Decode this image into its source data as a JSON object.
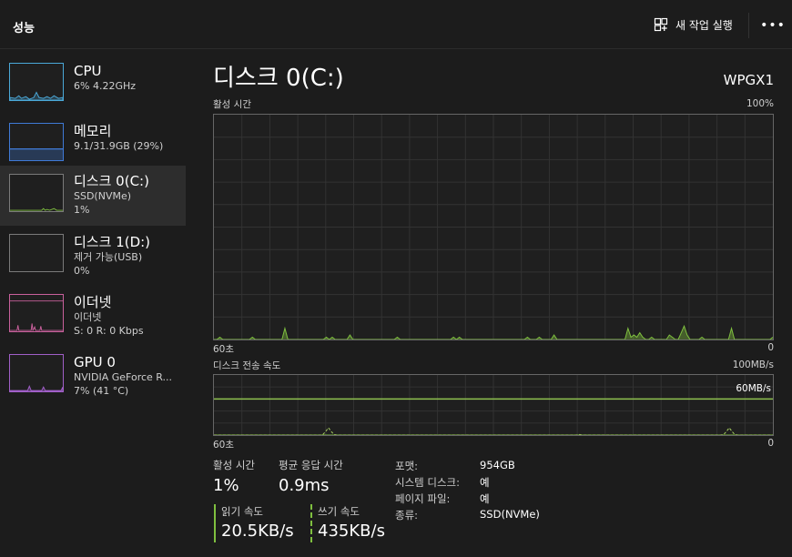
{
  "header": {
    "title": "성능",
    "new_task_label": "새 작업 실행",
    "more_label": "•••"
  },
  "sidebar": {
    "items": [
      {
        "name": "CPU",
        "sub1": "6% 4.22GHz",
        "sub2": "",
        "active": false,
        "color": "#4aa8d8"
      },
      {
        "name": "메모리",
        "sub1": "9.1/31.9GB (29%)",
        "sub2": "",
        "active": false,
        "color": "#3f7ad6"
      },
      {
        "name": "디스크 0(C:)",
        "sub1": "SSD(NVMe)",
        "sub2": "1%",
        "active": true,
        "color": "#7fbf3f"
      },
      {
        "name": "디스크 1(D:)",
        "sub1": "제거 가능(USB)",
        "sub2": "0%",
        "active": false,
        "color": "#7fbf3f"
      },
      {
        "name": "이더넷",
        "sub1": "이더넷",
        "sub2": "S: 0 R: 0 Kbps",
        "active": false,
        "color": "#c9609c"
      },
      {
        "name": "GPU 0",
        "sub1": "NVIDIA GeForce R...",
        "sub2": "7% (41 °C)",
        "active": false,
        "color": "#a05fc8"
      }
    ]
  },
  "detail": {
    "title": "디스크 0(C:)",
    "model": "WPGX1",
    "active_time_graph": {
      "label": "활성 시간",
      "max_label": "100%",
      "x_left": "60초",
      "x_right": "0",
      "values_percent": [
        0,
        0,
        1,
        0,
        0,
        0,
        0,
        0,
        0,
        0,
        0,
        0,
        0,
        1,
        0,
        0,
        0,
        0,
        0,
        0,
        0,
        0,
        0,
        0,
        5,
        0,
        0,
        0,
        0,
        0,
        0,
        0,
        0,
        0,
        0,
        0,
        0,
        0,
        1,
        0,
        1,
        0,
        0,
        0,
        0,
        0,
        2,
        0,
        0,
        0,
        0,
        0,
        0,
        0,
        0,
        0,
        0,
        0,
        0,
        0,
        0,
        0,
        1,
        0,
        0,
        0,
        0,
        0,
        0,
        0,
        0,
        0,
        0,
        0,
        0,
        0,
        0,
        0,
        0,
        0,
        0,
        1,
        0,
        1,
        0,
        0,
        0,
        0,
        0,
        0,
        0,
        0,
        0,
        0,
        0,
        0,
        0,
        0,
        0,
        0,
        0,
        0,
        0,
        0,
        0,
        0,
        1,
        0,
        0,
        0,
        1,
        0,
        0,
        0,
        0,
        2,
        0,
        0,
        0,
        0,
        0,
        0,
        0,
        0,
        0,
        0,
        0,
        0,
        0,
        0,
        0,
        0,
        0,
        0,
        0,
        0,
        0,
        0,
        0,
        0,
        5,
        1,
        2,
        1,
        3,
        1,
        0,
        0,
        1,
        0,
        0,
        0,
        0,
        0,
        2,
        1,
        0,
        0,
        3,
        6,
        2,
        0,
        0,
        0,
        0,
        1,
        0,
        0,
        0,
        0,
        0,
        0,
        0,
        0,
        0,
        5,
        0,
        0,
        0,
        0,
        0,
        0,
        0,
        0,
        0,
        0,
        0,
        0,
        0,
        1
      ]
    },
    "transfer_graph": {
      "label": "디스크 전송 속도",
      "max_label": "100MB/s",
      "line_label": "60MB/s",
      "line_value_mb": 60,
      "x_left": "60초",
      "x_right": "0",
      "read_mb": [
        0,
        0,
        0,
        0,
        0,
        0,
        0,
        0,
        0,
        0,
        0,
        0,
        0,
        0,
        0,
        0,
        0,
        0,
        0,
        0,
        0,
        0,
        0,
        0,
        0,
        0,
        0,
        0,
        0,
        0,
        0,
        0,
        0,
        0,
        0,
        0,
        0,
        0,
        0,
        0,
        0,
        0,
        0,
        0,
        0,
        0,
        0,
        0,
        0,
        0,
        0,
        0,
        0,
        0,
        0,
        0,
        0,
        0,
        0,
        0,
        0,
        0,
        0,
        0,
        0,
        0,
        0,
        0,
        0,
        0,
        0,
        0,
        0,
        0,
        0,
        0,
        0,
        0,
        0,
        0,
        0,
        0,
        0,
        0,
        0,
        0,
        0,
        0,
        0,
        0,
        0,
        0,
        0,
        0,
        0,
        0,
        0,
        0,
        0,
        0,
        0,
        0,
        0,
        0,
        0,
        0,
        0,
        0,
        0,
        0,
        0,
        0,
        0,
        0,
        0,
        0,
        0,
        0,
        0,
        0,
        0,
        0,
        0,
        0,
        0,
        0,
        0,
        0,
        0,
        0,
        0,
        0,
        0,
        0,
        0,
        0,
        0,
        0,
        0,
        0,
        0,
        0,
        0,
        0,
        0,
        0,
        0,
        0,
        0,
        0,
        0,
        0,
        0,
        0,
        0,
        0,
        0,
        0,
        0,
        0,
        0,
        0,
        0,
        0,
        0,
        0,
        0,
        0,
        0,
        0,
        0,
        0,
        0,
        0,
        0,
        0,
        0,
        0,
        0,
        0,
        0,
        0,
        0,
        0,
        0,
        0,
        0,
        0,
        0,
        0,
        0,
        0,
        0,
        0,
        0,
        0,
        0,
        0,
        0,
        0,
        0,
        0
      ],
      "write_mb": [
        0,
        0,
        0,
        0,
        0,
        0,
        0,
        0,
        0,
        0,
        0,
        0,
        0,
        0,
        0,
        0,
        0,
        0,
        0,
        0,
        0,
        0,
        0,
        0,
        0,
        0,
        0,
        0,
        0,
        0,
        0,
        0,
        0,
        0,
        0,
        0,
        0,
        0,
        0,
        0,
        1,
        6,
        12,
        6,
        1,
        0,
        0,
        0,
        0,
        0,
        0,
        0,
        0,
        0,
        0,
        0,
        0,
        0,
        0,
        0,
        0,
        0,
        0,
        0,
        0,
        0,
        0,
        0,
        0,
        0,
        0,
        0,
        0,
        0,
        0,
        0,
        0,
        0,
        0,
        0,
        0,
        0,
        0,
        0,
        0,
        0,
        0,
        0,
        0,
        0,
        0,
        0,
        0,
        0,
        0,
        0,
        0,
        0,
        0,
        0,
        0,
        0,
        0,
        0,
        0,
        0,
        0,
        0,
        0,
        0,
        0,
        0,
        0,
        0,
        0,
        0,
        0,
        0,
        0,
        0,
        0,
        0,
        0,
        0,
        0,
        0,
        0,
        0,
        0,
        0,
        0,
        0,
        0,
        0,
        1,
        0,
        0,
        0,
        0,
        0,
        0,
        0,
        0,
        0,
        0,
        0,
        0,
        0,
        0,
        0,
        0,
        0,
        0,
        0,
        0,
        0,
        0,
        0,
        0,
        0,
        0,
        0,
        0,
        0,
        0,
        0,
        0,
        0,
        0,
        0,
        0,
        0,
        0,
        0,
        0,
        0,
        0,
        0,
        0,
        0,
        0,
        0,
        0,
        0,
        0,
        0,
        0,
        1,
        6,
        12,
        6,
        1,
        0,
        0,
        0,
        0,
        0,
        0,
        0,
        0,
        0,
        0,
        0,
        0,
        0,
        0
      ]
    },
    "stats": {
      "active_time_label": "활성 시간",
      "active_time_value": "1%",
      "response_label": "평균 응답 시간",
      "response_value": "0.9ms",
      "read_label": "읽기 속도",
      "read_value": "20.5KB/s",
      "write_label": "쓰기 속도",
      "write_value": "435KB/s",
      "read_color": "#7fbf3f",
      "write_color": "#7fbf3f"
    },
    "properties": [
      {
        "key": "포맷:",
        "value": "954GB"
      },
      {
        "key": "시스템 디스크:",
        "value": "예"
      },
      {
        "key": "페이지 파일:",
        "value": "예"
      },
      {
        "key": "종류:",
        "value": "SSD(NVMe)"
      }
    ]
  }
}
